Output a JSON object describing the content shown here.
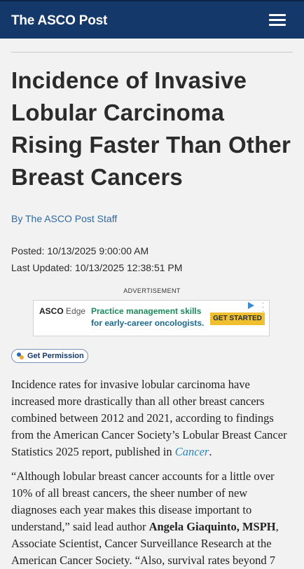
{
  "header": {
    "logo": "The ASCO Post",
    "menu_icon": "hamburger-menu-icon"
  },
  "article": {
    "title": "Incidence of Invasive Lobular Carcinoma Rising Faster Than Other Breast Cancers",
    "byline": "By The ASCO Post Staff",
    "posted": "Posted: 10/13/2025 9:00:00 AM",
    "updated": "Last Updated: 10/13/2025 12:38:51 PM"
  },
  "ad": {
    "label": "ADVERTISEMENT",
    "brand": "ASCO",
    "brand_sub": "Edge",
    "headline": "Practice management skills",
    "subline": "for early-career oncologists.",
    "cta": "GET STARTED"
  },
  "permission": {
    "label": "Get Permission"
  },
  "body": {
    "p1_text": "Incidence rates for invasive lobular carcinoma have increased more drastically than all other breast cancers combined between 2012 and 2021, according to findings from the American Cancer Society’s Lobular Breast Cancer Statistics 2025 report, published in ",
    "p1_link": "Cancer",
    "p1_end": ".",
    "p2_a": "“Although lobular breast cancer accounts for a little over 10% of all breast cancers, the sheer number of new diagnoses each year makes this disease important to understand,” said lead author ",
    "p2_name": "Angela Giaquinto, MSPH",
    "p2_b": ", Associate Scientist, Cancer Surveillance Research at the American Cancer Society. “Also, survival rates beyond 7"
  },
  "colors": {
    "header_bg": "#15386b",
    "byline": "#2e6aa3",
    "link": "#2a84b6",
    "cta": "#f0bf2f"
  }
}
